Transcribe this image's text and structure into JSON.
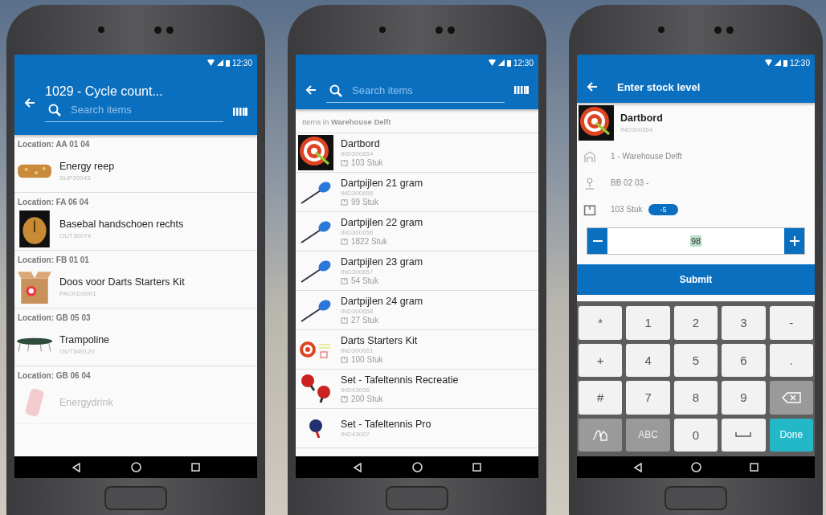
{
  "phones": [
    {
      "kind": "count_list",
      "status_time": "12:30",
      "title": "1029 - Cycle count...",
      "search": {
        "placeholder": "Search items"
      },
      "groups": [
        {
          "location": "Location: AA 01 04",
          "item": {
            "name": "Energy reep",
            "code": "SUP20043",
            "kind": "bar",
            "faded": false
          }
        },
        {
          "location": "Location: FA 06 04",
          "item": {
            "name": "Basebal handschoen rechts",
            "code": "OUT30074",
            "kind": "glove",
            "faded": false
          }
        },
        {
          "location": "Location: FB 01 01",
          "item": {
            "name": "Doos voor Darts Starters Kit",
            "code": "PACKDS001",
            "kind": "box",
            "faded": false
          }
        },
        {
          "location": "Location: GB 05 03",
          "item": {
            "name": "Trampoline",
            "code": "OUT349120",
            "kind": "trampoline",
            "faded": false
          }
        },
        {
          "location": "Location: GB 06 04",
          "item": {
            "name": "Energydrink",
            "kind": "drink",
            "faded": true
          }
        }
      ]
    },
    {
      "kind": "item_list",
      "status_time": "12:30",
      "search": {
        "placeholder": "Search items"
      },
      "subheader": "Items in **Warehouse Delft**",
      "items": [
        {
          "name": "Dartbord",
          "code": "IND300654",
          "stock": "103 Stuk",
          "kind": "dartboard"
        },
        {
          "name": "Dartpijlen 21 gram",
          "code": "IND300655",
          "stock": "99 Stuk",
          "kind": "dart"
        },
        {
          "name": "Dartpijlen 22 gram",
          "code": "IND300656",
          "stock": "1822 Stuk",
          "kind": "dart"
        },
        {
          "name": "Dartpijlen 23 gram",
          "code": "IND300657",
          "stock": "54 Stuk",
          "kind": "dart"
        },
        {
          "name": "Dartpijlen 24 gram",
          "code": "IND300658",
          "stock": "27 Stuk",
          "kind": "dart"
        },
        {
          "name": "Darts Starters Kit",
          "code": "IND300661",
          "stock": "100 Stuk",
          "kind": "kit"
        },
        {
          "name": "Set - Tafeltennis Recreatie",
          "code": "IND43006",
          "stock": "200 Stuk",
          "kind": "paddles"
        },
        {
          "name": "Set - Tafeltennis Pro",
          "code": "IND43007",
          "kind": "paddle"
        }
      ]
    },
    {
      "kind": "stock_entry",
      "status_time": "12:30",
      "title": "Enter stock level",
      "product": {
        "name": "Dartbord",
        "code": "IND300654",
        "kind": "dartboard"
      },
      "warehouse": "1 - Warehouse Delft",
      "location": "BB 02 03 -",
      "stock": "103 Stuk",
      "difference": "-5",
      "quantity": "98",
      "submit": "Submit",
      "keys": [
        {
          "kind": "key",
          "label": "*"
        },
        {
          "kind": "key",
          "label": "1"
        },
        {
          "kind": "key",
          "label": "2"
        },
        {
          "kind": "key",
          "label": "3"
        },
        {
          "kind": "key",
          "label": "-"
        },
        {
          "kind": "key",
          "label": "+"
        },
        {
          "kind": "key",
          "label": "4"
        },
        {
          "kind": "key",
          "label": "5"
        },
        {
          "kind": "key",
          "label": "6"
        },
        {
          "kind": "key",
          "label": "."
        },
        {
          "kind": "key",
          "label": "#"
        },
        {
          "kind": "key",
          "label": "7"
        },
        {
          "kind": "key",
          "label": "8"
        },
        {
          "kind": "key",
          "label": "9"
        },
        {
          "kind": "backspace"
        },
        {
          "kind": "handwriting"
        },
        {
          "kind": "function",
          "label": "ABC"
        },
        {
          "kind": "key",
          "label": "0"
        },
        {
          "kind": "space"
        },
        {
          "kind": "done",
          "label": "Done"
        }
      ]
    }
  ]
}
